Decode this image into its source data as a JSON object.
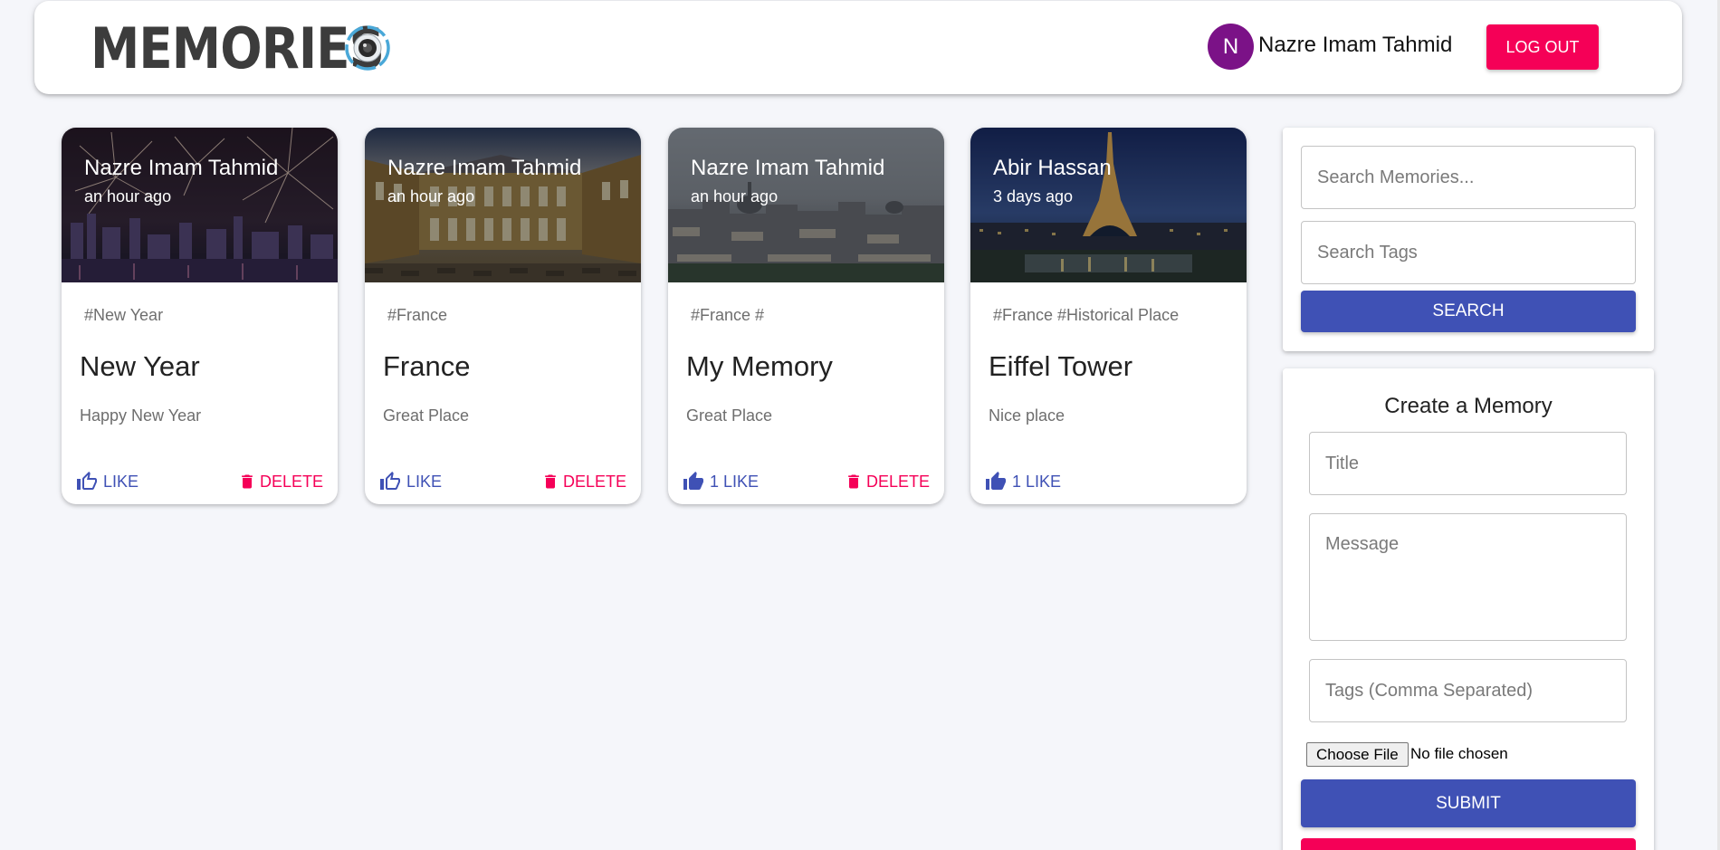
{
  "app": {
    "brand": "Memories",
    "logo_icon": "camera-lens-icon",
    "user": {
      "initial": "N",
      "name": "Nazre Imam Tahmid"
    },
    "logout_label": "Log out"
  },
  "colors": {
    "primary": "#3f51b5",
    "secondary": "#f50057",
    "avatar": "#7b1287",
    "background": "#f5f6fa"
  },
  "posts": [
    {
      "author": "Nazre Imam Tahmid",
      "time": "an hour ago",
      "tags": "#New Year",
      "title": "New Year",
      "message": "Happy New Year",
      "like_label": "Like",
      "like_icon": "thumb-up-outline-icon",
      "delete_label": "Delete",
      "image_subject": "fireworks-city-night"
    },
    {
      "author": "Nazre Imam Tahmid",
      "time": "an hour ago",
      "tags": "#France",
      "title": "France",
      "message": "Great Place",
      "like_label": "Like",
      "like_icon": "thumb-up-outline-icon",
      "delete_label": "Delete",
      "image_subject": "palace-courtyard"
    },
    {
      "author": "Nazre Imam Tahmid",
      "time": "an hour ago",
      "tags": "#France #",
      "title": "My Memory",
      "message": "Great Place",
      "like_label": "1 Like",
      "like_icon": "thumb-up-filled-icon",
      "delete_label": "Delete",
      "image_subject": "paris-rooftops"
    },
    {
      "author": "Abir Hassan",
      "time": "3 days ago",
      "tags": "#France #Historical Place",
      "title": "Eiffel Tower",
      "message": "Nice place",
      "like_label": "1 Like",
      "like_icon": "thumb-up-filled-icon",
      "image_subject": "eiffel-tower-night"
    }
  ],
  "search": {
    "memories_placeholder": "Search Memories...",
    "tags_placeholder": "Search Tags",
    "button_label": "Search"
  },
  "form": {
    "heading": "Create a Memory",
    "title_placeholder": "Title",
    "message_placeholder": "Message",
    "tags_placeholder": "Tags (Comma Separated)",
    "file_button": "Choose File",
    "file_status": "No file chosen",
    "submit_label": "Submit"
  }
}
